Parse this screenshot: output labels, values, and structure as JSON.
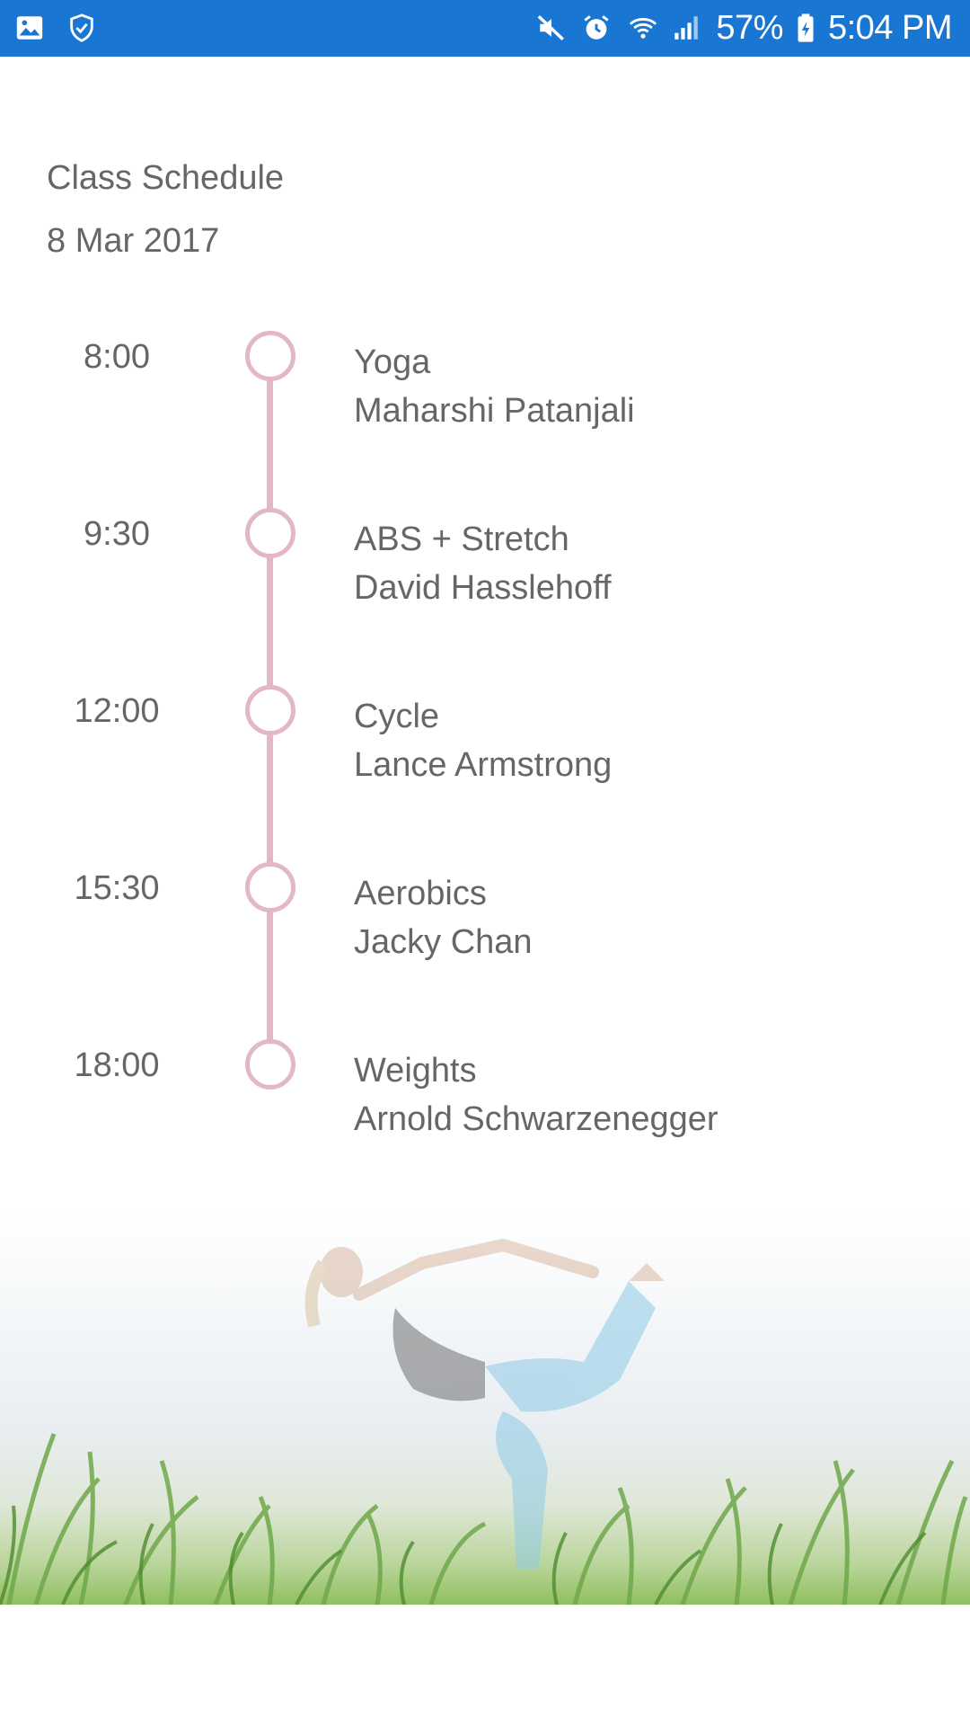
{
  "status_bar": {
    "left_icons": [
      "image-icon",
      "shield-check-icon"
    ],
    "right_icons": [
      "mute-icon",
      "alarm-icon",
      "wifi-icon",
      "signal-icon",
      "battery-icon"
    ],
    "battery": "57%",
    "time": "5:04 PM",
    "bg_color": "#1976D2"
  },
  "header": {
    "title": "Class Schedule",
    "date": "8 Mar 2017"
  },
  "timeline_color": "#E3B7C4",
  "schedule": [
    {
      "time": "8:00",
      "class": "Yoga",
      "instructor": "Maharshi Patanjali"
    },
    {
      "time": "9:30",
      "class": "ABS + Stretch",
      "instructor": "David Hasslehoff"
    },
    {
      "time": "12:00",
      "class": "Cycle",
      "instructor": "Lance Armstrong"
    },
    {
      "time": "15:30",
      "class": "Aerobics",
      "instructor": "Jacky Chan"
    },
    {
      "time": "18:00",
      "class": "Weights",
      "instructor": "Arnold Schwarzenegger"
    }
  ]
}
